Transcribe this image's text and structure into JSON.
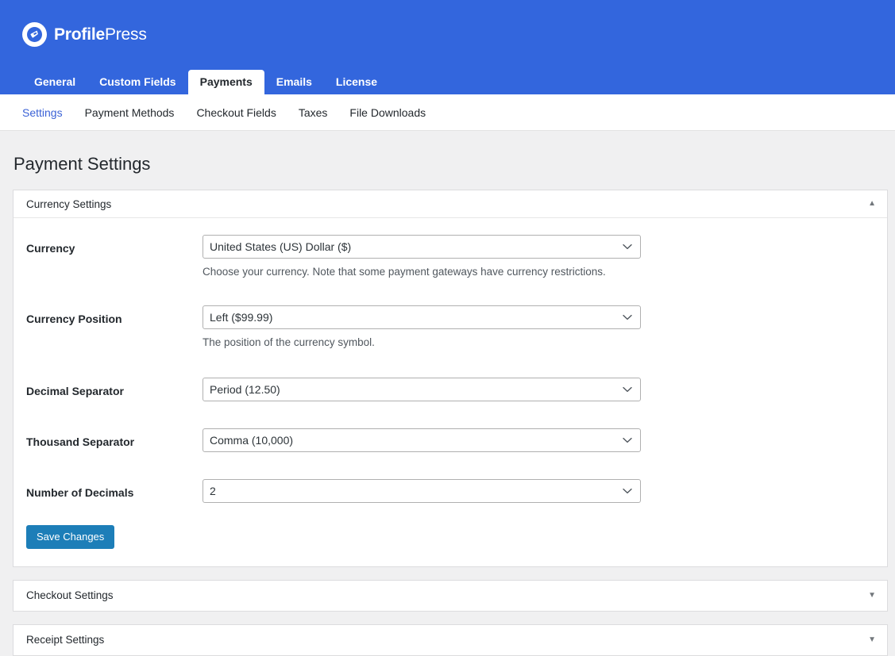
{
  "brand": {
    "name_bold": "Profile",
    "name_light": "Press",
    "logo_icon": "profilepress-nib-icon"
  },
  "main_tabs": [
    {
      "label": "General",
      "active": false
    },
    {
      "label": "Custom Fields",
      "active": false
    },
    {
      "label": "Payments",
      "active": true
    },
    {
      "label": "Emails",
      "active": false
    },
    {
      "label": "License",
      "active": false
    }
  ],
  "sub_nav": [
    {
      "label": "Settings",
      "active": true
    },
    {
      "label": "Payment Methods",
      "active": false
    },
    {
      "label": "Checkout Fields",
      "active": false
    },
    {
      "label": "Taxes",
      "active": false
    },
    {
      "label": "File Downloads",
      "active": false
    }
  ],
  "page": {
    "title": "Payment Settings"
  },
  "currency_panel": {
    "title": "Currency Settings",
    "toggle_icon": "chevron-up-icon",
    "toggle_glyph": "▲",
    "fields": {
      "currency": {
        "label": "Currency",
        "value": "United States (US) Dollar ($)",
        "description": "Choose your currency. Note that some payment gateways have currency restrictions."
      },
      "currency_position": {
        "label": "Currency Position",
        "value": "Left ($99.99)",
        "description": "The position of the currency symbol."
      },
      "decimal_separator": {
        "label": "Decimal Separator",
        "value": "Period (12.50)"
      },
      "thousand_separator": {
        "label": "Thousand Separator",
        "value": "Comma (10,000)"
      },
      "number_of_decimals": {
        "label": "Number of Decimals",
        "value": "2"
      }
    },
    "save_label": "Save Changes"
  },
  "collapsed_panels": [
    {
      "title": "Checkout Settings",
      "toggle_icon": "chevron-down-icon",
      "toggle_glyph": "▼"
    },
    {
      "title": "Receipt Settings",
      "toggle_icon": "chevron-down-icon",
      "toggle_glyph": "▼"
    }
  ],
  "colors": {
    "header_blue": "#3366dd",
    "active_link_blue": "#3b62d6",
    "save_button_blue": "#1d7eb8",
    "page_background": "#f0f0f1"
  }
}
